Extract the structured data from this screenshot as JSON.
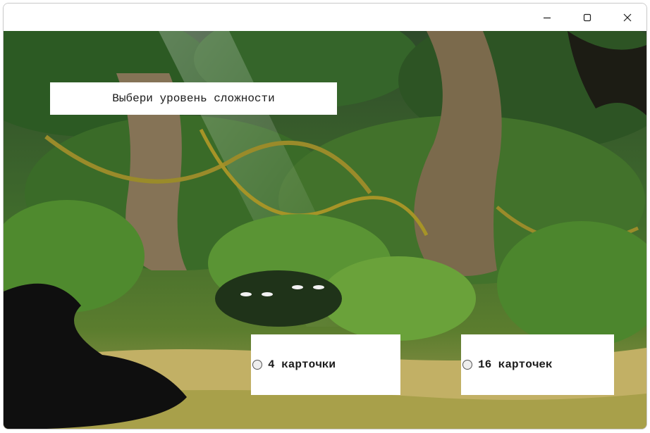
{
  "window": {
    "title": ""
  },
  "heading": {
    "text": "Выбери уровень сложности"
  },
  "options": [
    {
      "label": "4 карточки",
      "selected": false
    },
    {
      "label": "16 карточек",
      "selected": false
    }
  ],
  "colors": {
    "jungle_dark": "#1f3d1a",
    "jungle_mid": "#3f6b22",
    "leaf_light": "#8fbf3a",
    "trunk": "#7a6a4a",
    "ground": "#c9b66a"
  }
}
